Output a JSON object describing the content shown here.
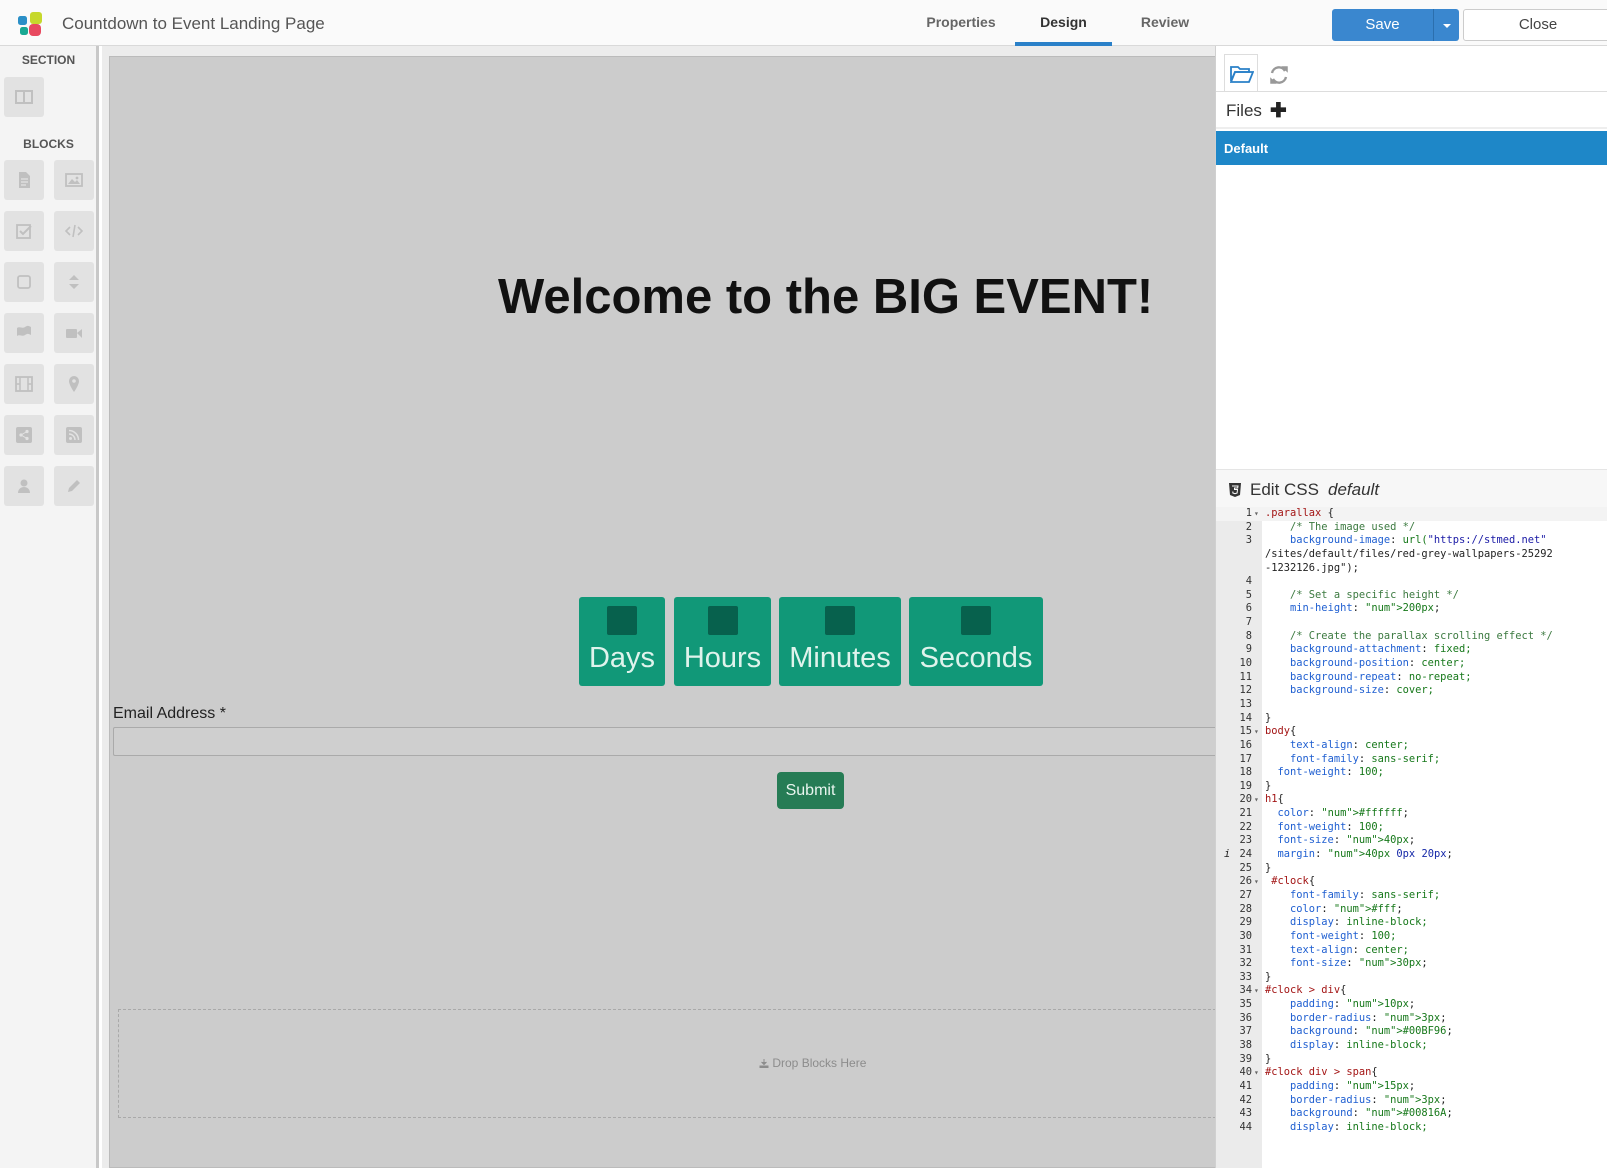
{
  "app": {
    "title": "Countdown to Event Landing Page"
  },
  "tabs": [
    {
      "label": "Properties",
      "active": false
    },
    {
      "label": "Design",
      "active": true
    },
    {
      "label": "Review",
      "active": false
    }
  ],
  "toolbar": {
    "save_label": "Save",
    "close_label": "Close"
  },
  "sidebar": {
    "section_heading": "SECTION",
    "blocks_heading": "BLOCKS",
    "section_tools": [
      "columns-icon"
    ],
    "block_tools": [
      "text-block-icon",
      "image-block-icon",
      "checkbox-block-icon",
      "code-block-icon",
      "button-block-icon",
      "spacer-block-icon",
      "flag-block-icon",
      "video-block-icon",
      "film-block-icon",
      "map-marker-block-icon",
      "share-block-icon",
      "rss-block-icon",
      "user-block-icon",
      "pencil-block-icon"
    ]
  },
  "canvas": {
    "headline": "Welcome to the BIG EVENT!",
    "clock": [
      "Days",
      "Hours",
      "Minutes",
      "Seconds"
    ],
    "email_label": "Email Address *",
    "email_value": "",
    "submit_label": "Submit",
    "dropzone_label": "Drop Blocks Here"
  },
  "right_panel": {
    "files_label": "Files",
    "files": [
      {
        "name": "Default",
        "selected": true
      }
    ],
    "css_title": "Edit CSS",
    "css_file": "default",
    "css_lines": [
      {
        "n": "1",
        "fold": true,
        "text": ".parallax {"
      },
      {
        "n": "2",
        "text": "    /* The image used */"
      },
      {
        "n": "3",
        "text": "    background-image: url(\"https://stmed.net"
      },
      {
        "n": "",
        "text": "/sites/default/files/red-grey-wallpapers-25292"
      },
      {
        "n": "",
        "text": "-1232126.jpg\");"
      },
      {
        "n": "4",
        "text": ""
      },
      {
        "n": "5",
        "text": "    /* Set a specific height */"
      },
      {
        "n": "6",
        "text": "    min-height: 200px;"
      },
      {
        "n": "7",
        "text": ""
      },
      {
        "n": "8",
        "text": "    /* Create the parallax scrolling effect */"
      },
      {
        "n": "9",
        "text": "    background-attachment: fixed;"
      },
      {
        "n": "10",
        "text": "    background-position: center;"
      },
      {
        "n": "11",
        "text": "    background-repeat: no-repeat;"
      },
      {
        "n": "12",
        "text": "    background-size: cover;"
      },
      {
        "n": "13",
        "text": ""
      },
      {
        "n": "14",
        "text": "}"
      },
      {
        "n": "15",
        "fold": true,
        "text": "body{"
      },
      {
        "n": "16",
        "text": "    text-align: center;"
      },
      {
        "n": "17",
        "text": "    font-family: sans-serif;"
      },
      {
        "n": "18",
        "text": "  font-weight: 100;"
      },
      {
        "n": "19",
        "text": "}"
      },
      {
        "n": "20",
        "fold": true,
        "text": "h1{"
      },
      {
        "n": "21",
        "text": "  color: #ffffff;"
      },
      {
        "n": "22",
        "text": "  font-weight: 100;"
      },
      {
        "n": "23",
        "text": "  font-size: 40px;"
      },
      {
        "n": "24",
        "info": true,
        "text": "  margin: 40px 0px 20px;"
      },
      {
        "n": "25",
        "text": "}"
      },
      {
        "n": "26",
        "fold": true,
        "text": " #clock{"
      },
      {
        "n": "27",
        "text": "    font-family: sans-serif;"
      },
      {
        "n": "28",
        "text": "    color: #fff;"
      },
      {
        "n": "29",
        "text": "    display: inline-block;"
      },
      {
        "n": "30",
        "text": "    font-weight: 100;"
      },
      {
        "n": "31",
        "text": "    text-align: center;"
      },
      {
        "n": "32",
        "text": "    font-size: 30px;"
      },
      {
        "n": "33",
        "text": "}"
      },
      {
        "n": "34",
        "fold": true,
        "text": "#clock > div{"
      },
      {
        "n": "35",
        "text": "    padding: 10px;"
      },
      {
        "n": "36",
        "text": "    border-radius: 3px;"
      },
      {
        "n": "37",
        "text": "    background: #00BF96;"
      },
      {
        "n": "38",
        "text": "    display: inline-block;"
      },
      {
        "n": "39",
        "text": "}"
      },
      {
        "n": "40",
        "fold": true,
        "text": "#clock div > span{"
      },
      {
        "n": "41",
        "text": "    padding: 15px;"
      },
      {
        "n": "42",
        "text": "    border-radius: 3px;"
      },
      {
        "n": "43",
        "text": "    background: #00816A;"
      },
      {
        "n": "44",
        "text": "    display: inline-block;"
      }
    ]
  },
  "colors": {
    "accent": "#3a87cf",
    "selected_file": "#1e87c8",
    "clock_box": "#119878",
    "clock_number": "#07614d",
    "submit": "#267c55"
  }
}
